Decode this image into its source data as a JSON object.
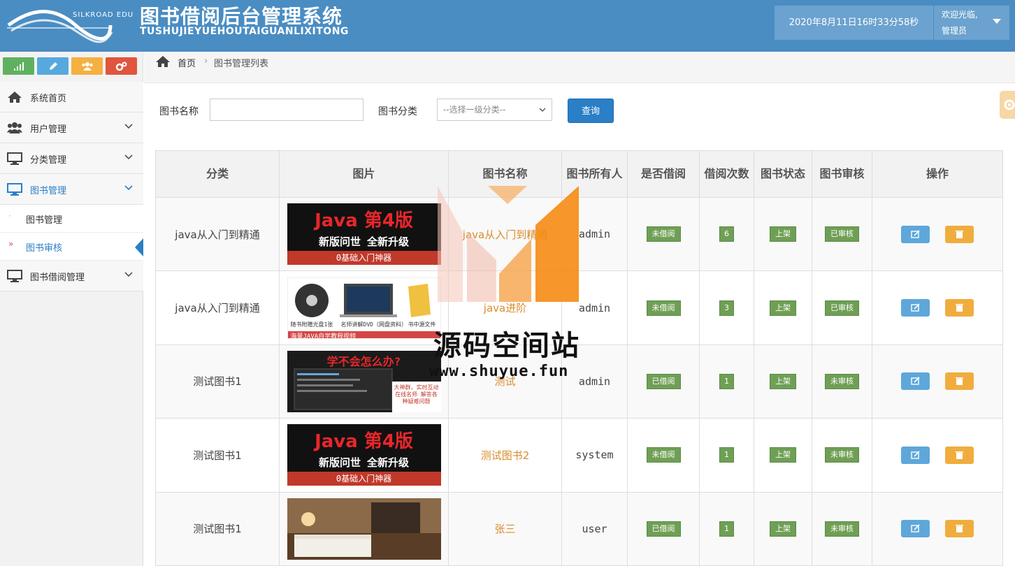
{
  "header": {
    "logo_text": "SILKROAD EDU",
    "title": "图书借阅后台管理系统",
    "subtitle": "TUSHUJIEYUEHOUTAIGUANLIXITONG",
    "datetime": "2020年8月11日16时33分58秒",
    "welcome": "欢迎光临,",
    "role": "管理员"
  },
  "colors": {
    "header_bg": "#4a8dc3",
    "accent_blue": "#2a7fc6",
    "tag_green": "#6f9f55",
    "link_orange": "#d98c2a",
    "delete_orange": "#f0ad3e",
    "edit_blue": "#5ea7da"
  },
  "shortcuts": [
    {
      "icon": "signal-icon",
      "color": "#5fb15f"
    },
    {
      "icon": "pencil-icon",
      "color": "#56a9de"
    },
    {
      "icon": "users-icon",
      "color": "#f5b041"
    },
    {
      "icon": "cogs-icon",
      "color": "#e0553d"
    }
  ],
  "sidebar": {
    "items": [
      {
        "label": "系统首页",
        "icon": "home-icon"
      },
      {
        "label": "用户管理",
        "icon": "users-icon"
      },
      {
        "label": "分类管理",
        "icon": "desktop-icon"
      },
      {
        "label": "图书管理",
        "icon": "desktop-icon",
        "active": true
      },
      {
        "label": "图书借阅管理",
        "icon": "desktop-icon"
      }
    ],
    "subitems": [
      {
        "label": "图书管理"
      },
      {
        "label": "图书审核",
        "active": true
      }
    ]
  },
  "breadcrumb": {
    "home": "首页",
    "current": "图书管理列表"
  },
  "search": {
    "name_label": "图书名称",
    "name_value": "",
    "category_label": "图书分类",
    "category_selected": "--选择一级分类--",
    "query_label": "查询"
  },
  "table": {
    "headers": [
      "分类",
      "图片",
      "图书名称",
      "图书所有人",
      "是否借阅",
      "借阅次数",
      "图书状态",
      "图书审核",
      "操作"
    ],
    "rows": [
      {
        "category": "java从入门到精通",
        "image": "java-4th-edition-banner",
        "name": "java从入门到精通",
        "owner": "admin",
        "borrowed": "未借阅",
        "count": "6",
        "status": "上架",
        "review": "已审核"
      },
      {
        "category": "java从入门到精通",
        "image": "java-dvd-package",
        "name": "java进阶",
        "owner": "admin",
        "borrowed": "未借阅",
        "count": "3",
        "status": "上架",
        "review": "已审核"
      },
      {
        "category": "测试图书1",
        "image": "learning-ad-banner",
        "name": "测试",
        "owner": "admin",
        "borrowed": "已借阅",
        "count": "1",
        "status": "上架",
        "review": "未审核"
      },
      {
        "category": "测试图书1",
        "image": "java-4th-edition-banner",
        "name": "测试图书2",
        "owner": "system",
        "borrowed": "未借阅",
        "count": "1",
        "status": "上架",
        "review": "未审核"
      },
      {
        "category": "测试图书1",
        "image": "hotel-room-photo",
        "name": "张三",
        "owner": "user",
        "borrowed": "已借阅",
        "count": "1",
        "status": "上架",
        "review": "未审核"
      }
    ]
  },
  "banner_java": {
    "line1": "Java 第4版",
    "line2": "新版问世 全新升级",
    "line3": "0基础入门神器"
  },
  "banner_dvd": {
    "caption1": "随书附赠光盘1张",
    "caption2": "名师讲解DVD（网盘资料）",
    "caption3": "书中源文件",
    "footer": "海量JAVA自学教程视频"
  },
  "banner_learn": {
    "title": "学不会怎么办?",
    "side": "大神群，实时互动 在线名师 解答各种疑难问题"
  },
  "watermark": {
    "text": "源码空间站",
    "url": "www.shuyue.fun"
  }
}
